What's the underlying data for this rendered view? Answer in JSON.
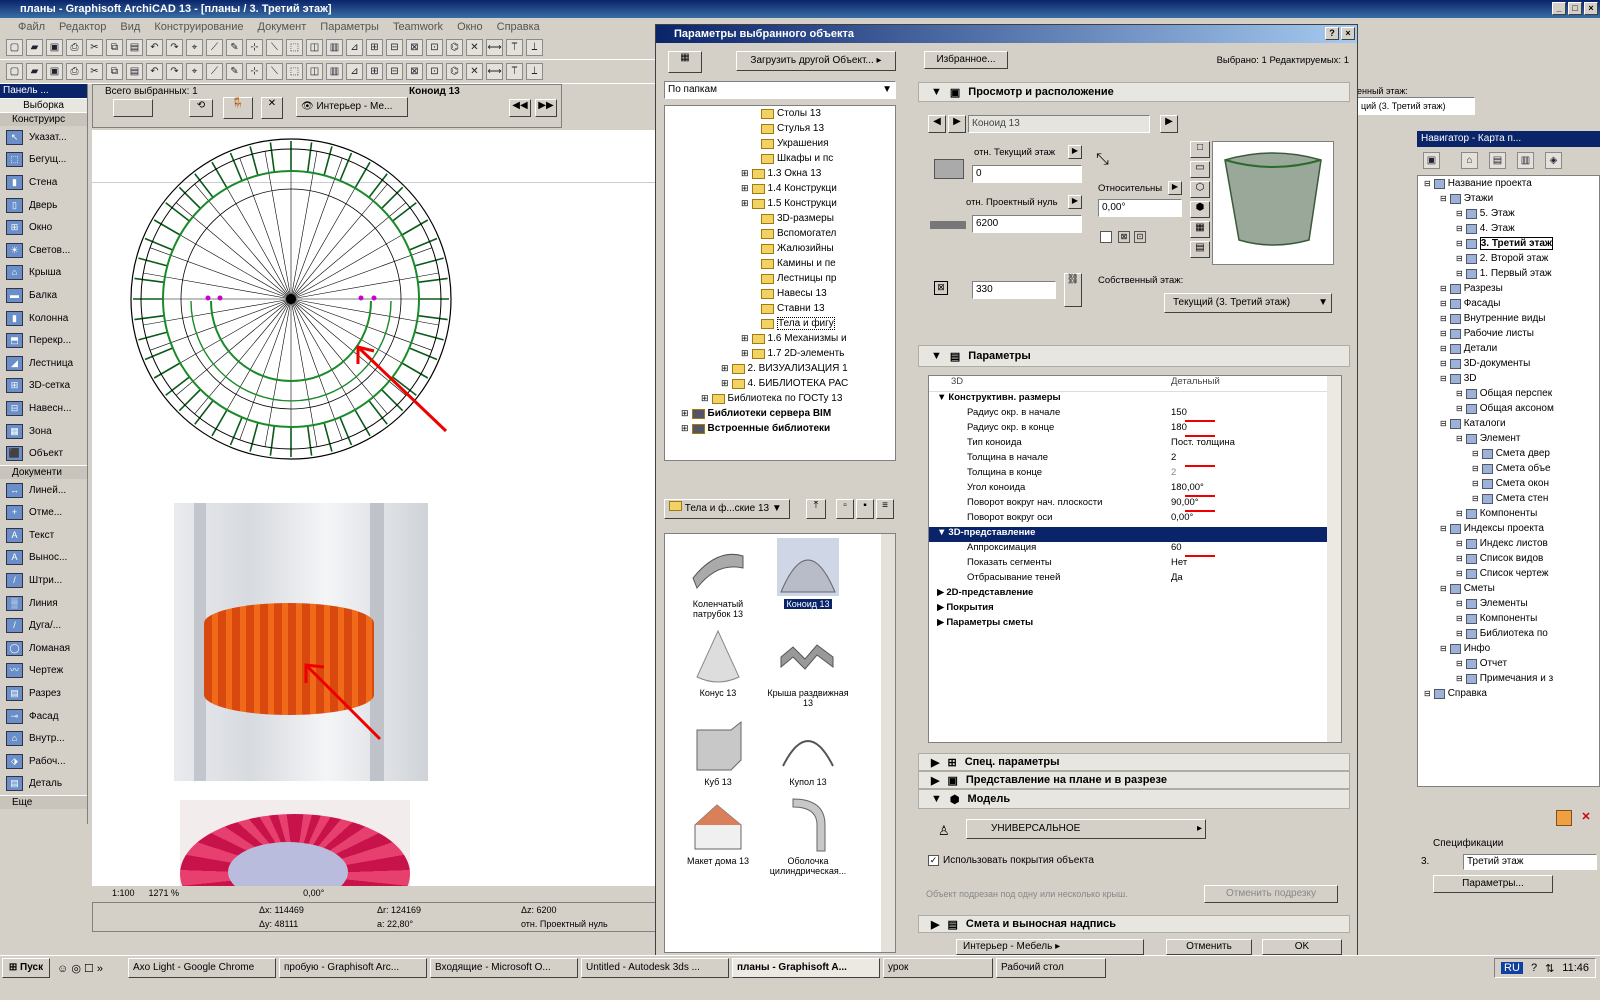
{
  "app": {
    "title": "планы - Graphisoft ArchiCAD 13 - [планы / 3. Третий этаж]",
    "menu": [
      "Файл",
      "Редактор",
      "Вид",
      "Конструирование",
      "Документ",
      "Параметры",
      "Teamwork",
      "Окно",
      "Справка"
    ]
  },
  "left_panel": {
    "title": "Панель ...",
    "selection": "Выборка",
    "sections": [
      "Конструирс",
      "Документи"
    ],
    "tools_design": [
      "Указат...",
      "Бегущ...",
      "Стена",
      "Дверь",
      "Окно",
      "Светов...",
      "Крыша",
      "Балка",
      "Колонна",
      "Перекр...",
      "Лестница",
      "3D-сетка",
      "Навесн...",
      "Зона",
      "Объект"
    ],
    "tools_doc": [
      "Линей...",
      "Отме...",
      "Текст",
      "Вынос...",
      "Штри...",
      "Линия",
      "Дуга/...",
      "Ломаная",
      "Чертеж",
      "Разрез",
      "Фасад",
      "Внутр...",
      "Рабоч...",
      "Деталь"
    ],
    "more": "Еще"
  },
  "info_box": {
    "selected": "Всего выбранных: 1",
    "view": "Интерьер - Ме...",
    "name": "Коноид 13"
  },
  "coords": {
    "scale": "1:100",
    "zoom": "1271 %",
    "angle": "0,00°",
    "dx": "Δx: 114469",
    "dy": "Δy: 48111",
    "dr": "Δr: 124169",
    "da": "a: 22,80°",
    "dz": "Δz: 6200",
    "ref": "отн. Проектный нуль"
  },
  "dialog": {
    "title": "Параметры выбранного объекта",
    "selected": "Выбрано: 1 Редактируемых: 1",
    "load_other": "Загрузить другой Объект...",
    "favorites": "Избранное...",
    "folder_view": "По папкам",
    "tree": [
      {
        "t": "Столы 13",
        "l": 5
      },
      {
        "t": "Стулья 13",
        "l": 5
      },
      {
        "t": "Украшения",
        "l": 5
      },
      {
        "t": "Шкафы и пс",
        "l": 5
      },
      {
        "t": "1.3 Окна 13",
        "l": 4
      },
      {
        "t": "1.4 Конструкци",
        "l": 4
      },
      {
        "t": "1.5 Конструкци",
        "l": 4
      },
      {
        "t": "3D-размеры",
        "l": 5
      },
      {
        "t": "Вспомогател",
        "l": 5
      },
      {
        "t": "Жалюзийны",
        "l": 5
      },
      {
        "t": "Камины и пе",
        "l": 5
      },
      {
        "t": "Лестницы пр",
        "l": 5
      },
      {
        "t": "Навесы 13",
        "l": 5
      },
      {
        "t": "Ставни 13",
        "l": 5
      },
      {
        "t": "Тела и фигу",
        "l": 5
      },
      {
        "t": "1.6 Механизмы и",
        "l": 4
      },
      {
        "t": "1.7 2D-элементь",
        "l": 4
      },
      {
        "t": "2. ВИЗУАЛИЗАЦИЯ 1",
        "l": 3
      },
      {
        "t": "4. БИБЛИОТЕКА РАС",
        "l": 3
      },
      {
        "t": "Библиотека по ГОСТу 13",
        "l": 2
      },
      {
        "t": "Библиотеки сервера BIM",
        "l": 1
      },
      {
        "t": "Встроенные библиотеки",
        "l": 1
      }
    ],
    "folder_select": "Тела и ф...ские 13",
    "objects": [
      {
        "n": "Коленчатый патрубок 13"
      },
      {
        "n": "Коноид 13"
      },
      {
        "n": "Конус 13"
      },
      {
        "n": "Крыша раздвижная 13"
      },
      {
        "n": "Куб 13"
      },
      {
        "n": "Купол 13"
      },
      {
        "n": "Макет дома 13"
      },
      {
        "n": "Оболочка цилиндрическая..."
      }
    ],
    "panel_view": "Просмотр и расположение",
    "obj_name": "Коноид 13",
    "rel_current": "отн. Текущий этаж",
    "rel_current_val": "0",
    "rel_project": "отн. Проектный нуль",
    "rel_project_val": "6200",
    "height_val": "330",
    "relative": "Относительны",
    "angle_val": "0,00°",
    "own_floor": "Собственный этаж:",
    "own_floor_val": "Текущий (3. Третий этаж)",
    "panel_params": "Параметры",
    "col_3d": "3D",
    "col_detail": "Детальный",
    "params": [
      {
        "n": "Конструктивн. размеры",
        "v": "",
        "g": 1
      },
      {
        "n": "Радиус окр. в начале",
        "v": "150"
      },
      {
        "n": "Радиус окр. в конце",
        "v": "180"
      },
      {
        "n": "Тип коноида",
        "v": "Пост. толщина"
      },
      {
        "n": "Толщина в начале",
        "v": "2"
      },
      {
        "n": "Толщина в конце",
        "v": "2"
      },
      {
        "n": "Угол коноида",
        "v": "180,00°"
      },
      {
        "n": "Поворот вокруг нач. плоскости",
        "v": "90,00°"
      },
      {
        "n": "Поворот вокруг оси",
        "v": "0,00°"
      },
      {
        "n": "3D-представление",
        "v": "",
        "g": 1,
        "sel": 1
      },
      {
        "n": "Аппроксимация",
        "v": "60"
      },
      {
        "n": "Показать сегменты",
        "v": "Нет"
      },
      {
        "n": "Отбрасывание теней",
        "v": "Да"
      },
      {
        "n": "2D-представление",
        "v": "",
        "g": 2
      },
      {
        "n": "Покрытия",
        "v": "",
        "g": 2
      },
      {
        "n": "Параметры сметы",
        "v": "",
        "g": 2
      }
    ],
    "panel_special": "Спец. параметры",
    "panel_plan": "Представление на плане и в разрезе",
    "panel_model": "Модель",
    "model_mat": "УНИВЕРСАЛЬНОЕ",
    "use_mat": "Использовать покрытия объекта",
    "trim_text": "Объект подрезан под одну или несколько крыш.",
    "cancel_trim": "Отменить подрезку",
    "panel_estimate": "Смета и выносная надпись",
    "layer": "Интерьер - Мебель",
    "cancel": "Отменить",
    "ok": "OK"
  },
  "floor_combo": {
    "label": "енный этаж:",
    "value": "ций (3. Третий этаж)"
  },
  "navigator": {
    "title": "Навигатор - Карта п...",
    "items": [
      {
        "t": "Название проекта",
        "l": 0
      },
      {
        "t": "Этажи",
        "l": 1
      },
      {
        "t": "5. Этаж",
        "l": 2
      },
      {
        "t": "4. Этаж",
        "l": 2
      },
      {
        "t": "3. Третий этаж",
        "l": 2
      },
      {
        "t": "2. Второй этаж",
        "l": 2
      },
      {
        "t": "1. Первый этаж",
        "l": 2
      },
      {
        "t": "Разрезы",
        "l": 1
      },
      {
        "t": "Фасады",
        "l": 1
      },
      {
        "t": "Внутренние виды",
        "l": 1
      },
      {
        "t": "Рабочие листы",
        "l": 1
      },
      {
        "t": "Детали",
        "l": 1
      },
      {
        "t": "3D-документы",
        "l": 1
      },
      {
        "t": "3D",
        "l": 1
      },
      {
        "t": "Общая перспек",
        "l": 2
      },
      {
        "t": "Общая аксоном",
        "l": 2
      },
      {
        "t": "Каталоги",
        "l": 1
      },
      {
        "t": "Элемент",
        "l": 2
      },
      {
        "t": "Смета двер",
        "l": 3
      },
      {
        "t": "Смета объе",
        "l": 3
      },
      {
        "t": "Смета окон",
        "l": 3
      },
      {
        "t": "Смета стен",
        "l": 3
      },
      {
        "t": "Компоненты",
        "l": 2
      },
      {
        "t": "Индексы проекта",
        "l": 1
      },
      {
        "t": "Индекс листов",
        "l": 2
      },
      {
        "t": "Список видов",
        "l": 2
      },
      {
        "t": "Список чертеж",
        "l": 2
      },
      {
        "t": "Сметы",
        "l": 1
      },
      {
        "t": "Элементы",
        "l": 2
      },
      {
        "t": "Компоненты",
        "l": 2
      },
      {
        "t": "Библиотека по",
        "l": 2
      },
      {
        "t": "Инфо",
        "l": 1
      },
      {
        "t": "Отчет",
        "l": 2
      },
      {
        "t": "Примечания и з",
        "l": 2
      },
      {
        "t": "Справка",
        "l": 0
      }
    ],
    "spec": "Спецификации",
    "spec_id": "3.",
    "spec_val": "Третий этаж",
    "spec_btn": "Параметры..."
  },
  "taskbar": {
    "start": "Пуск",
    "tasks": [
      "Axo Light - Google Chrome",
      "пробую - Graphisoft Arc...",
      "Входящие - Microsoft O...",
      "Untitled - Autodesk 3ds ...",
      "планы - Graphisoft A...",
      "урок",
      "Рабочий стол"
    ],
    "lang": "RU",
    "time": "11:46"
  }
}
